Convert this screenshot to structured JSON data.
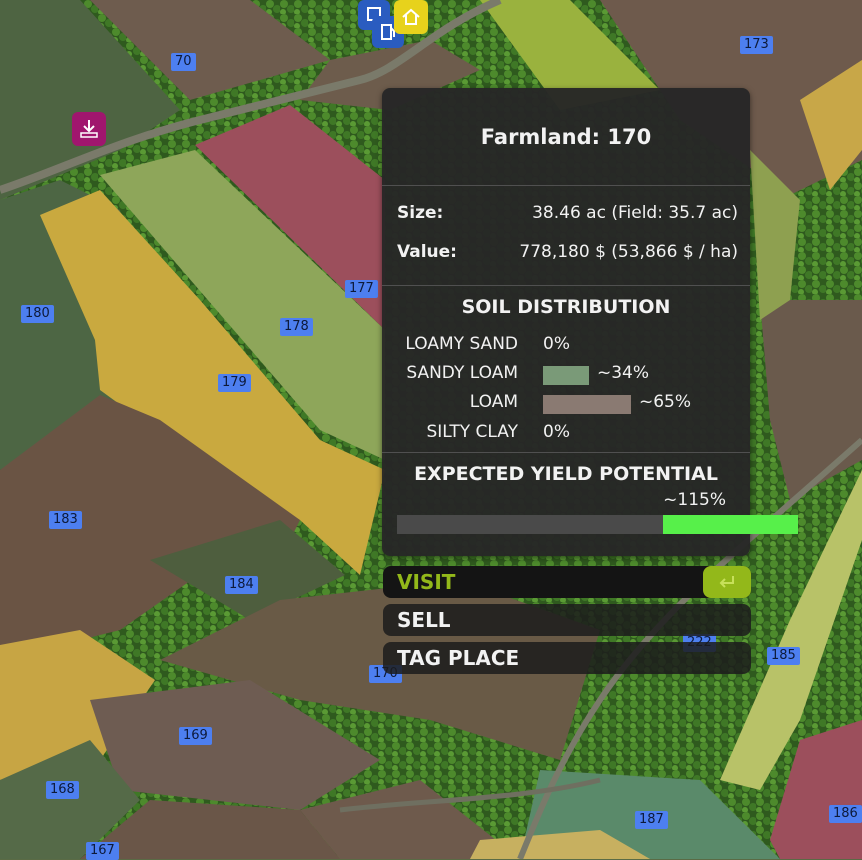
{
  "panel": {
    "title": "Farmland: 170",
    "size_label": "Size:",
    "size_value": "38.46 ac (Field: 35.7 ac)",
    "value_label": "Value:",
    "value_value": "778,180 $ (53,866 $ / ha)",
    "soil_title": "SOIL DISTRIBUTION",
    "soils": [
      {
        "name": "LOAMY SAND",
        "percent_text": "0%",
        "fraction": 0.0,
        "color": "#7a9a70"
      },
      {
        "name": "SANDY LOAM",
        "percent_text": "~34%",
        "fraction": 0.34,
        "color": "#7a9a78"
      },
      {
        "name": "LOAM",
        "percent_text": "~65%",
        "fraction": 0.65,
        "color": "#8a7a72"
      },
      {
        "name": "SILTY CLAY",
        "percent_text": "0%",
        "fraction": 0.0,
        "color": "#9a9a9a"
      }
    ],
    "yield_title": "EXPECTED YIELD POTENTIAL",
    "yield_text": "~115%",
    "yield_fraction": 1.15,
    "yield_color": "#57f04a"
  },
  "menu": {
    "visit": "VISIT",
    "sell": "SELL",
    "tag_place": "TAG PLACE",
    "accent": "#93b81a"
  },
  "map_labels": [
    "70",
    "173",
    "177",
    "178",
    "179",
    "180",
    "183",
    "184",
    "170",
    "222",
    "185",
    "169",
    "168",
    "167",
    "187",
    "186"
  ],
  "icons": {
    "download": "download-icon",
    "home": "home-icon",
    "fuel": "fuel-pump-icon"
  }
}
